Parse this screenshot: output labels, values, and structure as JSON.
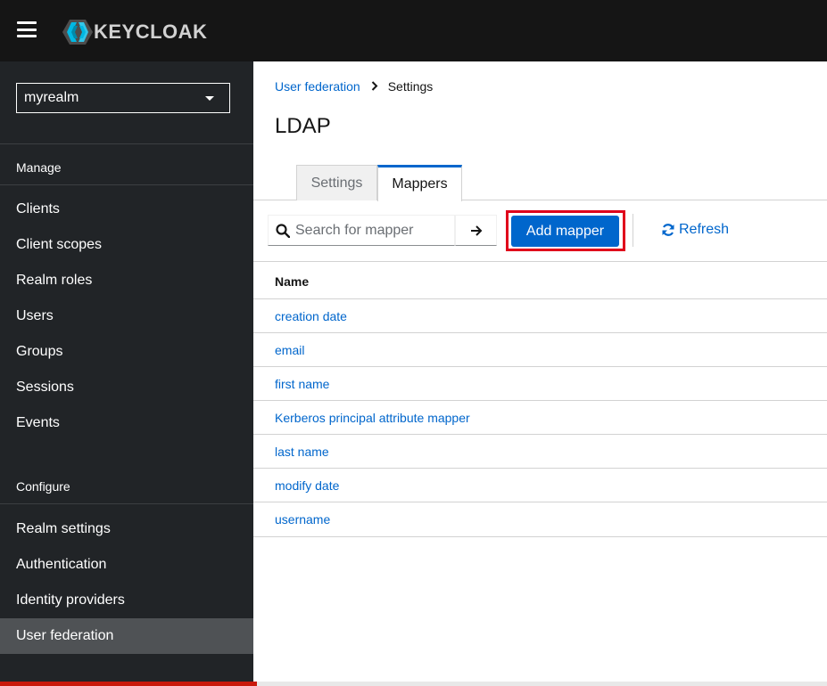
{
  "header": {
    "menu_icon": "hamburger-icon",
    "logo_text": "KEYCLOAK"
  },
  "sidebar": {
    "realm": "myrealm",
    "manage_label": "Manage",
    "manage_items": [
      {
        "label": "Clients"
      },
      {
        "label": "Client scopes"
      },
      {
        "label": "Realm roles"
      },
      {
        "label": "Users"
      },
      {
        "label": "Groups"
      },
      {
        "label": "Sessions"
      },
      {
        "label": "Events"
      }
    ],
    "configure_label": "Configure",
    "configure_items": [
      {
        "label": "Realm settings"
      },
      {
        "label": "Authentication"
      },
      {
        "label": "Identity providers"
      },
      {
        "label": "User federation",
        "active": true
      }
    ]
  },
  "breadcrumb": {
    "parent": "User federation",
    "current": "Settings"
  },
  "page_title": "LDAP",
  "tabs": [
    {
      "label": "Settings",
      "active": false
    },
    {
      "label": "Mappers",
      "active": true
    }
  ],
  "toolbar": {
    "search_placeholder": "Search for mapper",
    "add_label": "Add mapper",
    "refresh_label": "Refresh"
  },
  "table": {
    "column_name": "Name",
    "rows": [
      "creation date",
      "email",
      "first name",
      "Kerberos principal attribute mapper",
      "last name",
      "modify date",
      "username"
    ]
  },
  "colors": {
    "masthead": "#151515",
    "sidebar": "#212427",
    "sidebar_active": "#4f5255",
    "link": "#0066cc",
    "primary_button": "#0066cc",
    "highlight": "#e0001b"
  }
}
